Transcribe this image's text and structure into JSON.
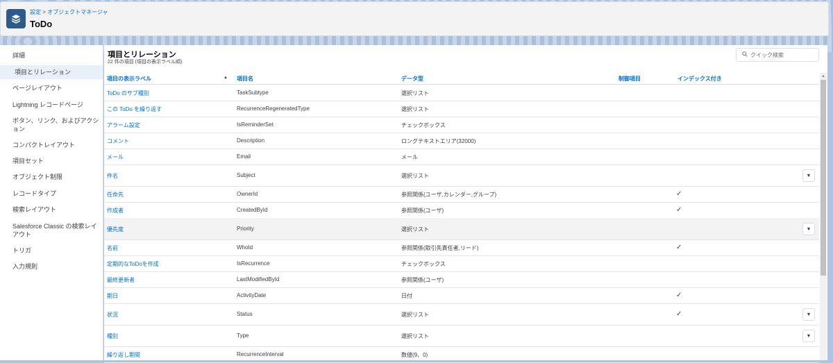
{
  "header": {
    "breadcrumb_part1": "設定",
    "breadcrumb_sep": ">",
    "breadcrumb_part2": "オブジェクトマネージャ",
    "title": "ToDo",
    "icon": "layers-icon"
  },
  "sidebar": {
    "items": [
      {
        "label": "詳細"
      },
      {
        "label": "項目とリレーション",
        "active": true
      },
      {
        "label": "ページレイアウト"
      },
      {
        "label": "Lightning レコードページ"
      },
      {
        "label": "ボタン、リンク、およびアクション"
      },
      {
        "label": "コンパクトレイアウト"
      },
      {
        "label": "項目セット"
      },
      {
        "label": "オブジェクト制限"
      },
      {
        "label": "レコードタイプ"
      },
      {
        "label": "検索レイアウト"
      },
      {
        "label": "Salesforce Classic の検索レイアウト"
      },
      {
        "label": "トリガ"
      },
      {
        "label": "入力規則"
      }
    ]
  },
  "main": {
    "title": "項目とリレーション",
    "subtitle": "22 件の項目 (項目の表示ラベル順)",
    "search_placeholder": "クイック検索",
    "columns": {
      "label": "項目の表示ラベル",
      "api": "項目名",
      "type": "データ型",
      "control": "制御項目",
      "indexed": "インデックス付き"
    },
    "rows": [
      {
        "label": "ToDo のサブ種別",
        "api": "TaskSubtype",
        "type": "選択リスト",
        "indexed": false,
        "dropdown": false
      },
      {
        "label": "この ToDo を繰り返す",
        "api": "RecurrenceRegeneratedType",
        "type": "選択リスト",
        "indexed": false,
        "dropdown": false
      },
      {
        "label": "アラーム設定",
        "api": "IsReminderSet",
        "type": "チェックボックス",
        "indexed": false,
        "dropdown": false
      },
      {
        "label": "コメント",
        "api": "Description",
        "type": "ロングテキストエリア(32000)",
        "indexed": false,
        "dropdown": false
      },
      {
        "label": "メール",
        "api": "Email",
        "type": "メール",
        "indexed": false,
        "dropdown": false
      },
      {
        "label": "件名",
        "api": "Subject",
        "type": "選択リスト",
        "indexed": false,
        "dropdown": true
      },
      {
        "label": "任命先",
        "api": "OwnerId",
        "type": "参照関係(ユーザ,カレンダー,グループ)",
        "indexed": true,
        "dropdown": false
      },
      {
        "label": "作成者",
        "api": "CreatedById",
        "type": "参照関係(ユーザ)",
        "indexed": true,
        "dropdown": false
      },
      {
        "label": "優先度",
        "api": "Priority",
        "type": "選択リスト",
        "indexed": false,
        "dropdown": true,
        "highlight": true
      },
      {
        "label": "名前",
        "api": "WhoId",
        "type": "参照関係(取引先責任者,リード)",
        "indexed": true,
        "dropdown": false
      },
      {
        "label": "定期的なToDoを作成",
        "api": "IsRecurrence",
        "type": "チェックボックス",
        "indexed": false,
        "dropdown": false
      },
      {
        "label": "最終更新者",
        "api": "LastModifiedById",
        "type": "参照関係(ユーザ)",
        "indexed": false,
        "dropdown": false
      },
      {
        "label": "期日",
        "api": "ActivityDate",
        "type": "日付",
        "indexed": true,
        "dropdown": false
      },
      {
        "label": "状況",
        "api": "Status",
        "type": "選択リスト",
        "indexed": true,
        "dropdown": true
      },
      {
        "label": "種別",
        "api": "Type",
        "type": "選択リスト",
        "indexed": false,
        "dropdown": true
      },
      {
        "label": "繰り返し期間",
        "api": "RecurrenceInterval",
        "type": "数値(9、0)",
        "indexed": false,
        "dropdown": false
      }
    ],
    "checkmark": "✓",
    "dropdown_glyph": "▼"
  },
  "colors": {
    "link": "#0070d2",
    "header_icon_bg": "#2e5c8a",
    "active_nav_bg": "#e8f0f9"
  }
}
